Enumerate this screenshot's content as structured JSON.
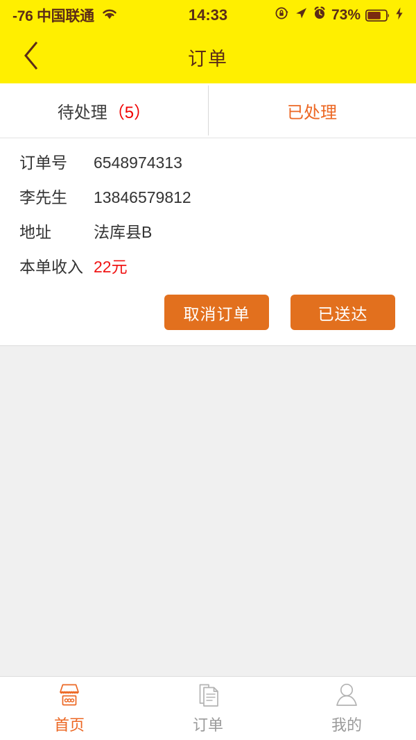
{
  "status_bar": {
    "carrier": "-76 中国联通",
    "wifi_icon": "wifi-icon",
    "time": "14:33",
    "rotation_lock_icon": "rotation-lock-icon",
    "location_icon": "location-arrow-icon",
    "alarm_icon": "alarm-clock-icon",
    "battery_percent": "73%",
    "battery_icon": "battery-icon",
    "charging_icon": "lightning-bolt-icon",
    "text_color": "#5b2c17",
    "background": "#ffef00"
  },
  "nav_bar": {
    "back_icon": "chevron-left-icon",
    "title": "订单",
    "background": "#ffef00",
    "text_color": "#5b2c17"
  },
  "tabs": [
    {
      "label": "待处理",
      "count": "（5）",
      "active": true,
      "color": "#3b3b3b",
      "count_color": "#f00000"
    },
    {
      "label": "已处理",
      "count": "",
      "active": false,
      "color": "#ec6723",
      "count_color": "#ec6723"
    }
  ],
  "order": {
    "rows": [
      {
        "label": "订单号",
        "value": "6548974313",
        "highlight": false
      },
      {
        "label": "李先生",
        "value": "13846579812",
        "highlight": false
      },
      {
        "label": "地址",
        "value": "法库县B",
        "highlight": false
      },
      {
        "label": "本单收入",
        "value": "22元",
        "highlight": true
      }
    ],
    "cancel_button": "取消订单",
    "delivered_button": "已送达",
    "button_color": "#e2701e",
    "money_color": "#f01414"
  },
  "tabbar": {
    "items": [
      {
        "label": "首页",
        "icon": "storefront-icon",
        "active": true
      },
      {
        "label": "订单",
        "icon": "documents-icon",
        "active": false
      },
      {
        "label": "我的",
        "icon": "person-icon",
        "active": false
      }
    ],
    "active_color": "#ec6723",
    "inactive_color": "#9a9a9a"
  }
}
